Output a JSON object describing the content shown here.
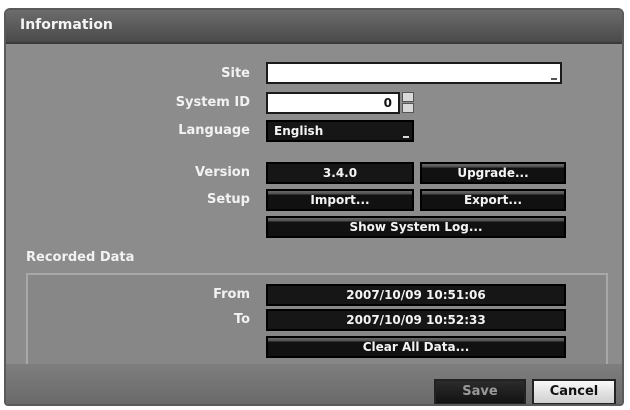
{
  "window": {
    "title": "Information"
  },
  "fields": {
    "site_label": "Site",
    "site_value": "",
    "system_id_label": "System ID",
    "system_id_value": "0",
    "language_label": "Language",
    "language_value": "English",
    "version_label": "Version",
    "version_value": "3.4.0",
    "setup_label": "Setup"
  },
  "buttons": {
    "upgrade": "Upgrade...",
    "import": "Import...",
    "export": "Export...",
    "show_system_log": "Show System Log..."
  },
  "recorded": {
    "section_title": "Recorded Data",
    "from_label": "From",
    "from_value": "2007/10/09  10:51:06",
    "to_label": "To",
    "to_value": "2007/10/09  10:52:33",
    "clear_button": "Clear All Data..."
  },
  "footer": {
    "save": "Save",
    "cancel": "Cancel"
  }
}
